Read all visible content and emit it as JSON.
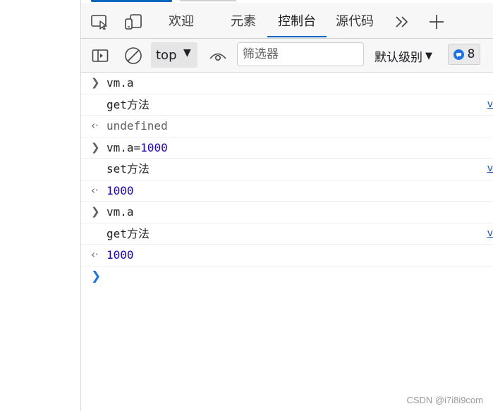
{
  "tabs": [
    {
      "label": "欢迎",
      "active": false
    },
    {
      "label": "元素",
      "active": false
    },
    {
      "label": "控制台",
      "active": true
    },
    {
      "label": "源代码",
      "active": false
    }
  ],
  "toolbar": {
    "context": "top",
    "filter_placeholder": "筛选器",
    "levels_label": "默认级别",
    "issues_count": "8"
  },
  "console": [
    {
      "kind": "input",
      "text": "vm.a"
    },
    {
      "kind": "log",
      "text": "get方法",
      "source": "v"
    },
    {
      "kind": "result",
      "text": "undefined",
      "style": "undef"
    },
    {
      "kind": "input",
      "lhs": "vm.a=",
      "rhs": "1000"
    },
    {
      "kind": "log",
      "text": "set方法",
      "source": "v"
    },
    {
      "kind": "result",
      "text": "1000",
      "style": "num"
    },
    {
      "kind": "input",
      "text": "vm.a"
    },
    {
      "kind": "log",
      "text": "get方法",
      "source": "v"
    },
    {
      "kind": "result",
      "text": "1000",
      "style": "num"
    }
  ],
  "watermark": "CSDN @i7i8i9com",
  "colors": {
    "accent": "#0067c0",
    "number": "#1c00cf",
    "link": "#1a55b8"
  },
  "icons": [
    "inspect-icon",
    "device-emulation-icon",
    "more-tabs-icon",
    "add-tab-icon",
    "sidebar-toggle-icon",
    "clear-console-icon",
    "live-expression-eye-icon",
    "issues-icon"
  ]
}
